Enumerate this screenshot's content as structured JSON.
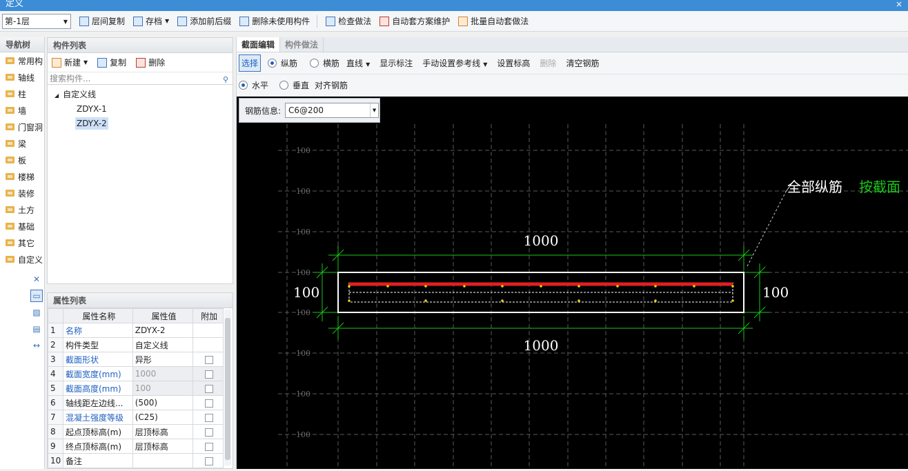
{
  "window": {
    "title": "定义",
    "close": "×"
  },
  "toolbar": {
    "floor": "第-1层",
    "buttons": [
      "层间复制",
      "存档",
      "添加前后缀",
      "删除未使用构件",
      "检查做法",
      "自动套方案维护",
      "批量自动套做法"
    ]
  },
  "nav": {
    "header": "导航树",
    "items": [
      "常用构",
      "轴线",
      "柱",
      "墙",
      "门窗洞",
      "梁",
      "板",
      "楼梯",
      "装修",
      "土方",
      "基础",
      "其它",
      "自定义"
    ]
  },
  "components": {
    "header": "构件列表",
    "new_label": "新建",
    "copy_label": "复制",
    "delete_label": "删除",
    "search_placeholder": "搜索构件...",
    "tree_root": "自定义线",
    "items": [
      "ZDYX-1",
      "ZDYX-2"
    ]
  },
  "properties": {
    "header": "属性列表",
    "columns": [
      "属性名称",
      "属性值",
      "附加"
    ],
    "rows": [
      {
        "n": "1",
        "name": "名称",
        "value": "ZDYX-2"
      },
      {
        "n": "2",
        "name": "构件类型",
        "value": "自定义线"
      },
      {
        "n": "3",
        "name": "截面形状",
        "value": "异形"
      },
      {
        "n": "4",
        "name": "截面宽度(mm)",
        "value": "1000"
      },
      {
        "n": "5",
        "name": "截面高度(mm)",
        "value": "100"
      },
      {
        "n": "6",
        "name": "轴线距左边线...",
        "value": "(500)"
      },
      {
        "n": "7",
        "name": "混凝土强度等级",
        "value": "(C25)"
      },
      {
        "n": "8",
        "name": "起点顶标高(m)",
        "value": "层顶标高"
      },
      {
        "n": "9",
        "name": "终点顶标高(m)",
        "value": "层顶标高"
      },
      {
        "n": "10",
        "name": "备注",
        "value": ""
      }
    ]
  },
  "editor": {
    "tabs": [
      "截面编辑",
      "构件做法"
    ],
    "row1": {
      "select": "选择",
      "radio_longitudinal": "纵筋",
      "radio_transverse": "横筋",
      "line": "直线",
      "show_marks": "显示标注",
      "manual_ref": "手动设置参考线",
      "set_elev": "设置标高",
      "delete": "删除",
      "clear": "清空钢筋"
    },
    "row2": {
      "horizontal": "水平",
      "vertical": "垂直",
      "align": "对齐钢筋"
    },
    "rebar_label": "钢筋信息:",
    "rebar_value": "C6@200"
  },
  "drawing": {
    "grid_label": "100",
    "dim_width": "1000",
    "dim_height": "100",
    "annotation_white": "全部纵筋",
    "annotation_green": "按截面"
  }
}
